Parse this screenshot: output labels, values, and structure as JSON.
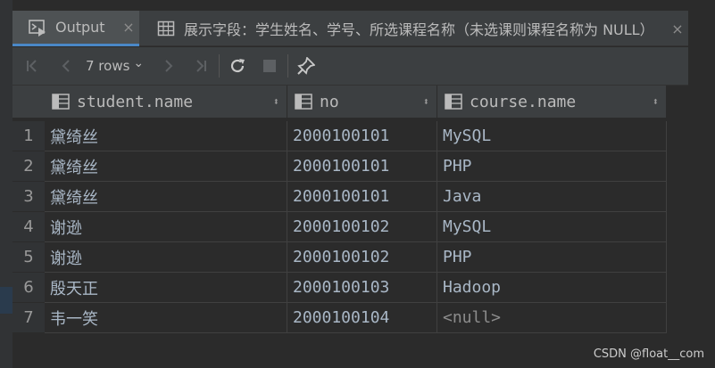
{
  "tabs": [
    {
      "label": "Output",
      "close": "×"
    },
    {
      "label": "展示字段：学生姓名、学号、所选课程名称（未选课则课程名称为 NULL）",
      "close": "×"
    }
  ],
  "toolbar": {
    "rows_label": "7 rows",
    "rows_arrow": "⌄"
  },
  "columns": [
    {
      "label": "student.name",
      "sort": "⬍"
    },
    {
      "label": "no",
      "sort": "⬍"
    },
    {
      "label": "course.name",
      "sort": "⬍"
    }
  ],
  "rows": [
    {
      "num": "1",
      "name": "黛绮丝",
      "no": "2000100101",
      "course": "MySQL"
    },
    {
      "num": "2",
      "name": "黛绮丝",
      "no": "2000100101",
      "course": "PHP"
    },
    {
      "num": "3",
      "name": "黛绮丝",
      "no": "2000100101",
      "course": "Java"
    },
    {
      "num": "4",
      "name": "谢逊",
      "no": "2000100102",
      "course": "MySQL"
    },
    {
      "num": "5",
      "name": "谢逊",
      "no": "2000100102",
      "course": "PHP"
    },
    {
      "num": "6",
      "name": "殷天正",
      "no": "2000100103",
      "course": "Hadoop"
    },
    {
      "num": "7",
      "name": "韦一笑",
      "no": "2000100104",
      "course": "<null>"
    }
  ],
  "watermark": "CSDN @float__com",
  "colors": {
    "accent": "#4a88c7",
    "background": "#2b2b2b",
    "panel": "#3c3f41"
  }
}
